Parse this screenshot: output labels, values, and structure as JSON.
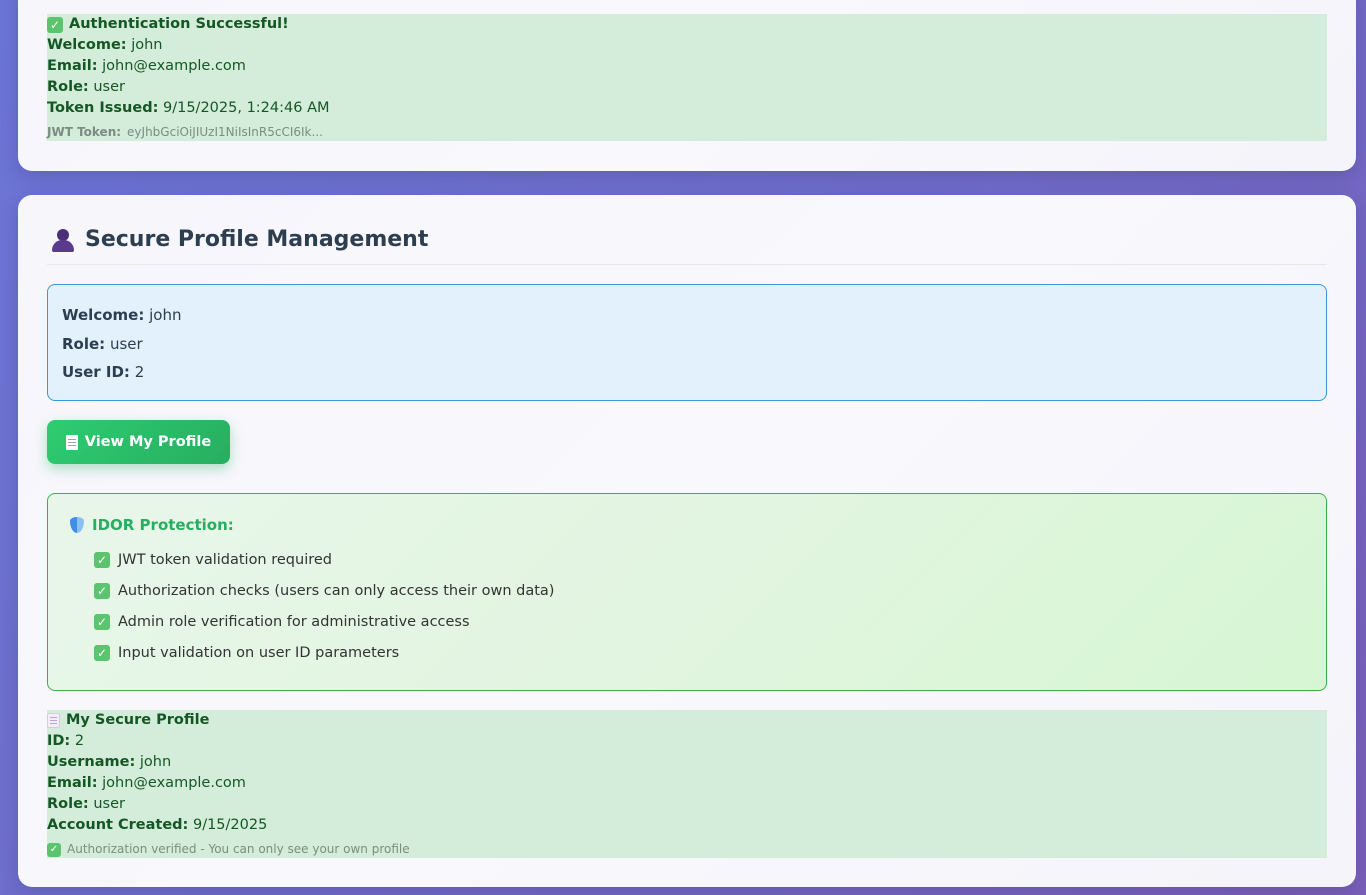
{
  "auth_result": {
    "header": "Authentication Successful!",
    "rows": [
      {
        "label": "Welcome:",
        "value": "john"
      },
      {
        "label": "Email:",
        "value": "john@example.com"
      },
      {
        "label": "Role:",
        "value": "user"
      },
      {
        "label": "Token Issued:",
        "value": "9/15/2025, 1:24:46 AM"
      }
    ],
    "jwt_label": "JWT Token:",
    "jwt_value": "eyJhbGciOiJIUzI1NiIsInR5cCI6Ik..."
  },
  "profile_section": {
    "title": "Secure Profile Management",
    "info": [
      {
        "label": "Welcome:",
        "value": "john"
      },
      {
        "label": "Role:",
        "value": "user"
      },
      {
        "label": "User ID:",
        "value": "2"
      }
    ],
    "view_button": "View My Profile",
    "idor": {
      "title": "IDOR Protection:",
      "items": [
        "JWT token validation required",
        "Authorization checks (users can only access their own data)",
        "Admin role verification for administrative access",
        "Input validation on user ID parameters"
      ]
    },
    "my_profile": {
      "header": "My Secure Profile",
      "rows": [
        {
          "label": "ID:",
          "value": "2"
        },
        {
          "label": "Username:",
          "value": "john"
        },
        {
          "label": "Email:",
          "value": "john@example.com"
        },
        {
          "label": "Role:",
          "value": "user"
        },
        {
          "label": "Account Created:",
          "value": "9/15/2025"
        }
      ],
      "note": "Authorization verified - You can only see your own profile"
    }
  },
  "colors": {
    "success_bg": "#d4ecda",
    "success_text": "#155724",
    "info_border": "#3a97d8",
    "button_green": "#2ecc71",
    "idor_border": "#37b24d"
  },
  "icons": {
    "success": "check-mark-icon",
    "user": "user-silhouette-icon",
    "document": "page-icon",
    "shield": "shield-icon",
    "memo": "memo-icon"
  }
}
